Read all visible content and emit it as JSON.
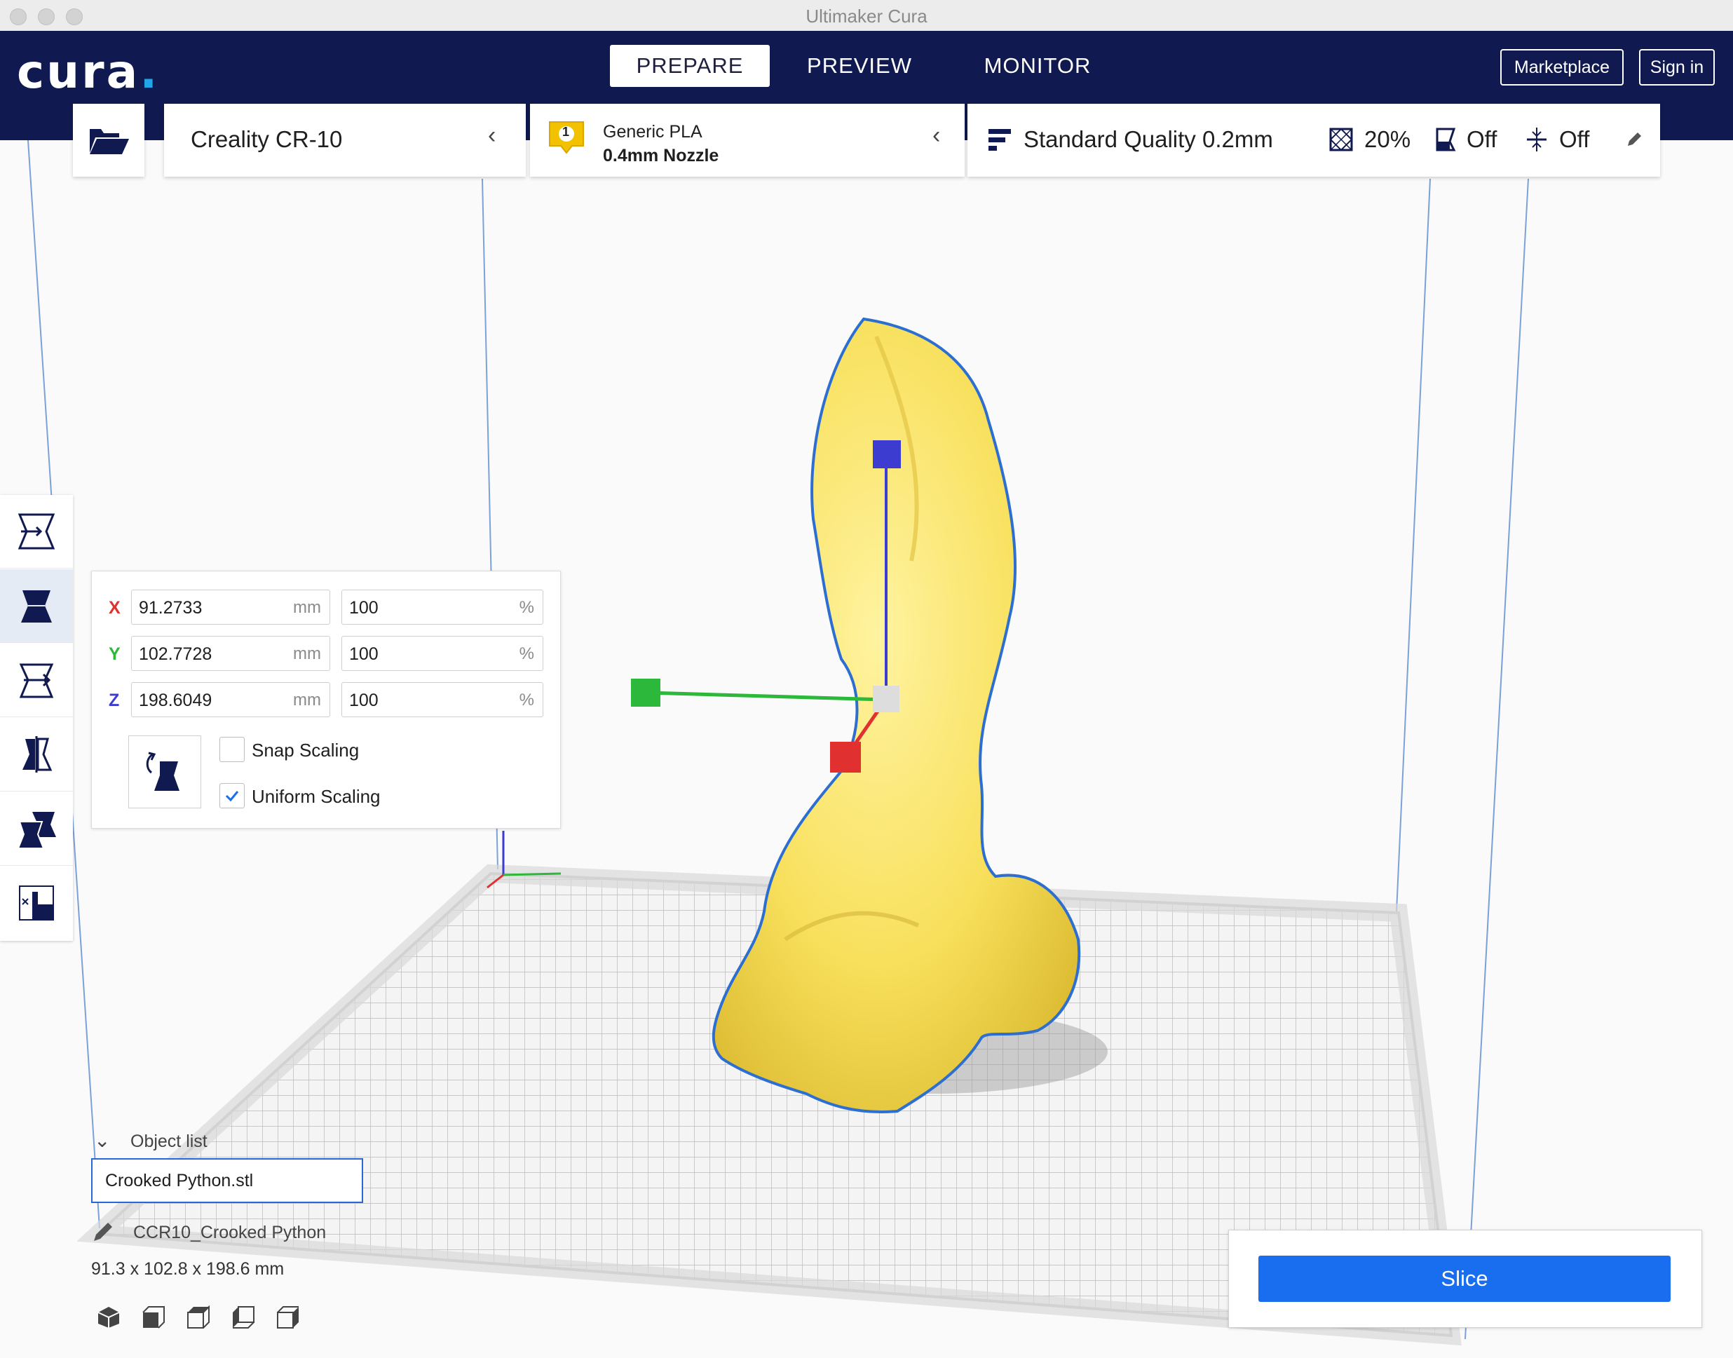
{
  "window": {
    "title": "Ultimaker Cura"
  },
  "header": {
    "logo": "cura",
    "logo_dot": ".",
    "tabs": [
      {
        "label": "PREPARE",
        "active": true
      },
      {
        "label": "PREVIEW",
        "active": false
      },
      {
        "label": "MONITOR",
        "active": false
      }
    ],
    "marketplace_label": "Marketplace",
    "signin_label": "Sign in"
  },
  "machine": {
    "name": "Creality CR-10"
  },
  "material": {
    "extruder": "1",
    "name": "Generic PLA",
    "nozzle": "0.4mm Nozzle",
    "color": "#f2c200"
  },
  "print_settings": {
    "profile": "Standard Quality 0.2mm",
    "infill": "20%",
    "support": "Off",
    "adhesion": "Off"
  },
  "tools": [
    {
      "name": "move",
      "active": false
    },
    {
      "name": "scale",
      "active": true
    },
    {
      "name": "rotate",
      "active": false
    },
    {
      "name": "mirror",
      "active": false
    },
    {
      "name": "per-model-settings",
      "active": false
    },
    {
      "name": "support-blocker",
      "active": false
    }
  ],
  "scale_panel": {
    "x": {
      "label": "X",
      "mm": "91.2733",
      "unit_mm": "mm",
      "percent": "100",
      "unit_pct": "%"
    },
    "y": {
      "label": "Y",
      "mm": "102.7728",
      "unit_mm": "mm",
      "percent": "100",
      "unit_pct": "%"
    },
    "z": {
      "label": "Z",
      "mm": "198.6049",
      "unit_mm": "mm",
      "percent": "100",
      "unit_pct": "%"
    },
    "snap_scaling": {
      "label": "Snap Scaling",
      "checked": false
    },
    "uniform_scaling": {
      "label": "Uniform Scaling",
      "checked": true
    }
  },
  "object_list": {
    "header": "Object list",
    "items": [
      "Crooked Python.stl"
    ],
    "job_name": "CCR10_Crooked Python",
    "dimensions": "91.3 x 102.8 x 198.6 mm"
  },
  "slice": {
    "label": "Slice"
  },
  "colors": {
    "header_bg": "#101a51",
    "accent_blue": "#196ef0",
    "model_yellow": "#f8e05c",
    "axis_x": "#e03030",
    "axis_y": "#2cb83a",
    "axis_z": "#3c3cd0"
  }
}
